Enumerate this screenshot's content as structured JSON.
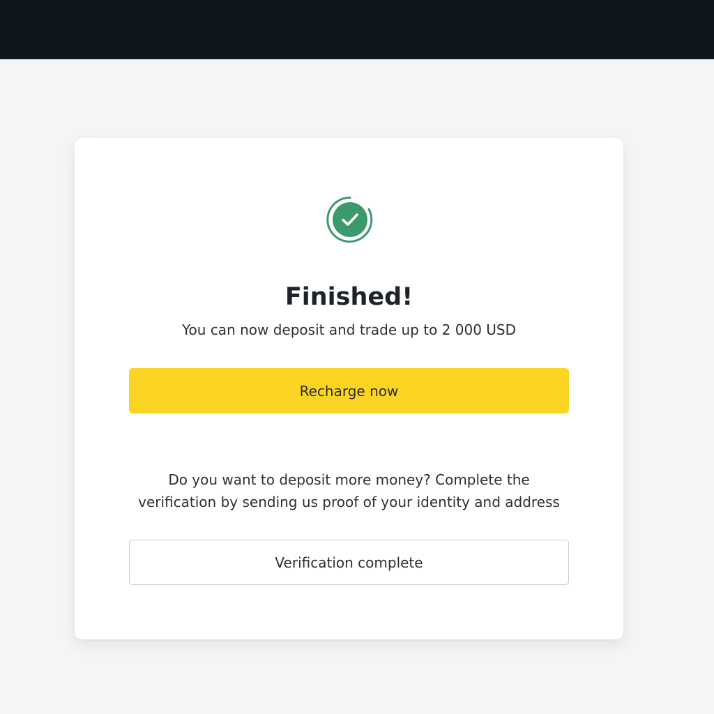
{
  "header": {
    "background_color": "#0f171d"
  },
  "result": {
    "icon": "check-circle-icon",
    "icon_color": "#3a9a6b",
    "title": "Finished!",
    "subtitle": "You can now deposit and trade up to 2 000 USD"
  },
  "actions": {
    "primary_label": "Recharge now",
    "primary_color": "#fcd524",
    "secondary_label": "Verification complete"
  },
  "verification_note": {
    "line1": "Do you want to deposit more money? Complete the",
    "line2": "verification by sending us proof of your identity and address"
  }
}
